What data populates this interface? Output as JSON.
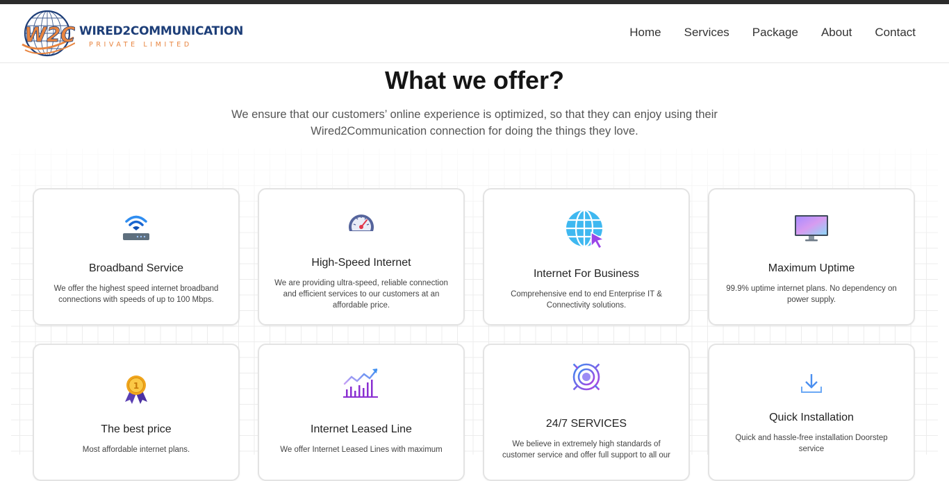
{
  "brand": {
    "logo_letters": "W2C",
    "name": "WIRED2COMMUNICATION",
    "subtitle": "PRIVATE LIMITED"
  },
  "nav": {
    "items": [
      {
        "label": "Home"
      },
      {
        "label": "Services"
      },
      {
        "label": "Package"
      },
      {
        "label": "About"
      },
      {
        "label": "Contact"
      }
    ]
  },
  "section": {
    "title": "What we offer?",
    "description": "We ensure that our customers’ online experience is optimized, so that they can enjoy using their Wired2Communication connection for doing the things they love."
  },
  "services": [
    {
      "title": "Broadband Service",
      "description": "We offer the highest speed internet broadband connections with speeds of up to 100 Mbps.",
      "icon": "wifi-router-icon"
    },
    {
      "title": "High-Speed Internet",
      "description": "We are providing ultra-speed, reliable connection and efficient services to our customers at an affordable price.",
      "icon": "speedometer-icon"
    },
    {
      "title": "Internet For Business",
      "description": "Comprehensive end to end Enterprise IT & Connectivity solutions.",
      "icon": "globe-cursor-icon"
    },
    {
      "title": "Maximum Uptime",
      "description": "99.9% uptime internet plans. No dependency on power supply.",
      "icon": "monitor-icon"
    },
    {
      "title": "The best price",
      "description": "Most affordable internet plans.",
      "icon": "medal-icon"
    },
    {
      "title": "Internet Leased Line",
      "description": "We offer Internet Leased Lines with maximum",
      "icon": "growth-chart-icon"
    },
    {
      "title": "24/7 SERVICES",
      "description": "We believe in extremely high standards of customer service and offer full support to all our",
      "icon": "gear-icon"
    },
    {
      "title": "Quick Installation",
      "description": "Quick and hassle-free installation Doorstep service",
      "icon": "download-icon"
    }
  ],
  "colors": {
    "brand_blue": "#1d3e78",
    "brand_orange": "#e8843f",
    "topbar": "#2c2c2c"
  }
}
